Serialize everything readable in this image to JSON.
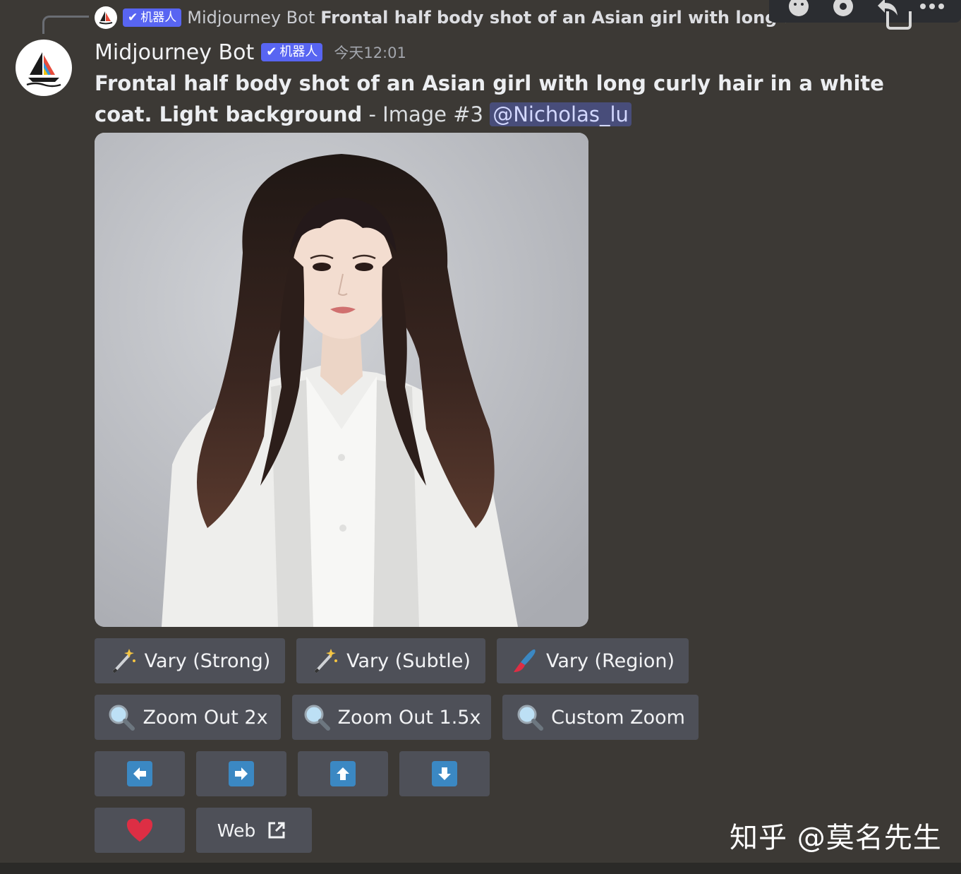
{
  "reply": {
    "bot_tag": "机器人",
    "author": "Midjourney Bot",
    "text": "Frontal half body shot of an Asian girl with long curly hair in a white coat. Light background"
  },
  "header": {
    "author": "Midjourney Bot",
    "bot_tag": "机器人",
    "timestamp": "今天12:01"
  },
  "message": {
    "prompt": "Frontal half body shot of an Asian girl with long curly hair in a white coat. Light background",
    "suffix": " - Image #3 ",
    "mention": "@Nicholas_lu"
  },
  "buttons": {
    "vary_strong": "Vary (Strong)",
    "vary_subtle": "Vary (Subtle)",
    "vary_region": "Vary (Region)",
    "zoom_out_2x": "Zoom Out 2x",
    "zoom_out_1_5x": "Zoom Out 1.5x",
    "custom_zoom": "Custom Zoom",
    "web": "Web"
  },
  "watermark": "知乎 @莫名先生",
  "colors": {
    "background": "#3c3935",
    "button": "#4e5058",
    "bot_tag": "#5865f2",
    "arrow": "#3b88c3",
    "heart": "#dd2e44"
  }
}
